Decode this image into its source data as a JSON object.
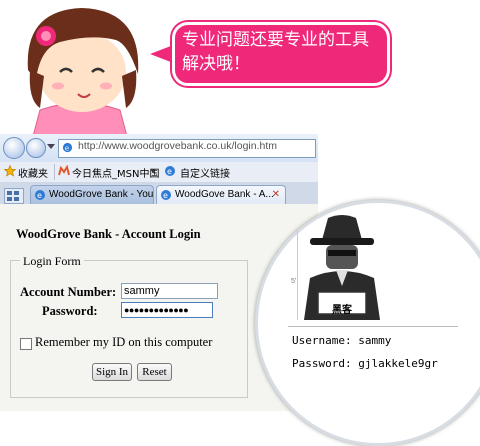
{
  "bubble": {
    "text": "专业问题还要专业的工具解决哦！"
  },
  "browser": {
    "url": "http://www.woodgrovebank.co.uk/login.htm",
    "favorites": {
      "label": "收藏夹",
      "items": [
        "今日焦点_MSN中国",
        "自定义链接"
      ]
    },
    "tabs": [
      {
        "label": "WoodGrove Bank - You..."
      },
      {
        "label": "WoodGove Bank - A..."
      }
    ]
  },
  "page": {
    "title": "WoodGrove Bank - Account Login",
    "form_legend": "Login Form",
    "account_label": "Account Number:",
    "account_value": "sammy",
    "password_label": "Password:",
    "password_value": "●●●●●●●●●●●●●",
    "remember_label": "Remember my ID on this computer",
    "signin_label": "Sign In",
    "reset_label": "Reset"
  },
  "magnifier": {
    "hacker_label": "黑客",
    "tick_label": "5'",
    "username_line": "Username: sammy",
    "password_line": "Password: gjlakkele9gr"
  },
  "colors": {
    "bubble": "#f0287a",
    "hair": "#6b2e1a",
    "shirt": "#ff8fb8"
  }
}
